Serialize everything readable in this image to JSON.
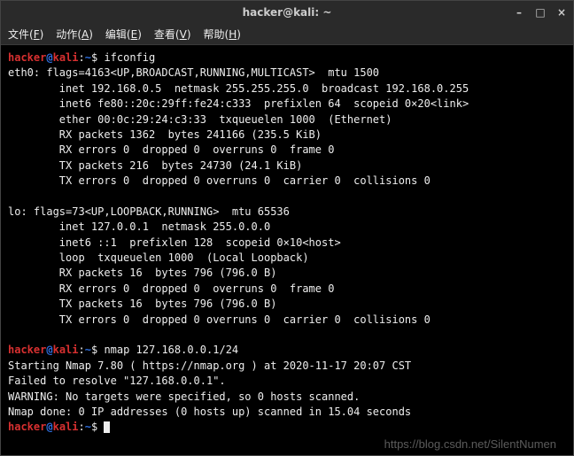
{
  "window": {
    "title": "hacker@kali: ~"
  },
  "menubar": {
    "file": {
      "label": "文件",
      "accel": "F"
    },
    "action": {
      "label": "动作",
      "accel": "A"
    },
    "edit": {
      "label": "编辑",
      "accel": "E"
    },
    "view": {
      "label": "查看",
      "accel": "V"
    },
    "help": {
      "label": "帮助",
      "accel": "H"
    }
  },
  "prompt": {
    "user": "hacker",
    "host": "kali",
    "path": "~",
    "sep": ":",
    "end": "$"
  },
  "commands": {
    "cmd1": "ifconfig",
    "cmd2": "nmap 127.168.0.0.1/24",
    "cmd3": ""
  },
  "output": {
    "ifconfig_eth0_header": "eth0: flags=4163<UP,BROADCAST,RUNNING,MULTICAST>  mtu 1500",
    "ifconfig_eth0_inet": "        inet 192.168.0.5  netmask 255.255.255.0  broadcast 192.168.0.255",
    "ifconfig_eth0_inet6": "        inet6 fe80::20c:29ff:fe24:c333  prefixlen 64  scopeid 0×20<link>",
    "ifconfig_eth0_ether": "        ether 00:0c:29:24:c3:33  txqueuelen 1000  (Ethernet)",
    "ifconfig_eth0_rxp": "        RX packets 1362  bytes 241166 (235.5 KiB)",
    "ifconfig_eth0_rxe": "        RX errors 0  dropped 0  overruns 0  frame 0",
    "ifconfig_eth0_txp": "        TX packets 216  bytes 24730 (24.1 KiB)",
    "ifconfig_eth0_txe": "        TX errors 0  dropped 0 overruns 0  carrier 0  collisions 0",
    "blank1": "",
    "ifconfig_lo_header": "lo: flags=73<UP,LOOPBACK,RUNNING>  mtu 65536",
    "ifconfig_lo_inet": "        inet 127.0.0.1  netmask 255.0.0.0",
    "ifconfig_lo_inet6": "        inet6 ::1  prefixlen 128  scopeid 0×10<host>",
    "ifconfig_lo_loop": "        loop  txqueuelen 1000  (Local Loopback)",
    "ifconfig_lo_rxp": "        RX packets 16  bytes 796 (796.0 B)",
    "ifconfig_lo_rxe": "        RX errors 0  dropped 0  overruns 0  frame 0",
    "ifconfig_lo_txp": "        TX packets 16  bytes 796 (796.0 B)",
    "ifconfig_lo_txe": "        TX errors 0  dropped 0 overruns 0  carrier 0  collisions 0",
    "blank2": "",
    "nmap1": "Starting Nmap 7.80 ( https://nmap.org ) at 2020-11-17 20:07 CST",
    "nmap2": "Failed to resolve \"127.168.0.0.1\".",
    "nmap3": "WARNING: No targets were specified, so 0 hosts scanned.",
    "nmap4": "Nmap done: 0 IP addresses (0 hosts up) scanned in 15.04 seconds"
  },
  "watermark": "https://blog.csdn.net/SilentNumen"
}
